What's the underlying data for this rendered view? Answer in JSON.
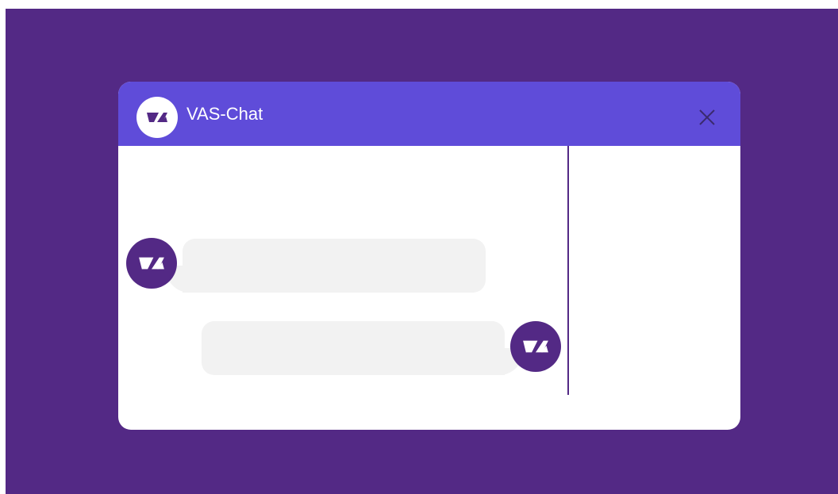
{
  "window": {
    "title": "VAS-Chat",
    "close_icon": "close-icon",
    "logo_icon": "vas-logo-icon"
  },
  "messages": [
    {
      "sender": "bot",
      "avatar_icon": "vas-logo-icon",
      "text": ""
    },
    {
      "sender": "user",
      "avatar_icon": "vas-logo-icon",
      "text": ""
    }
  ],
  "colors": {
    "backdrop": "#532985",
    "header": "#5f4cd9",
    "avatar": "#532985",
    "bubble": "#f2f2f2",
    "window": "#ffffff"
  }
}
